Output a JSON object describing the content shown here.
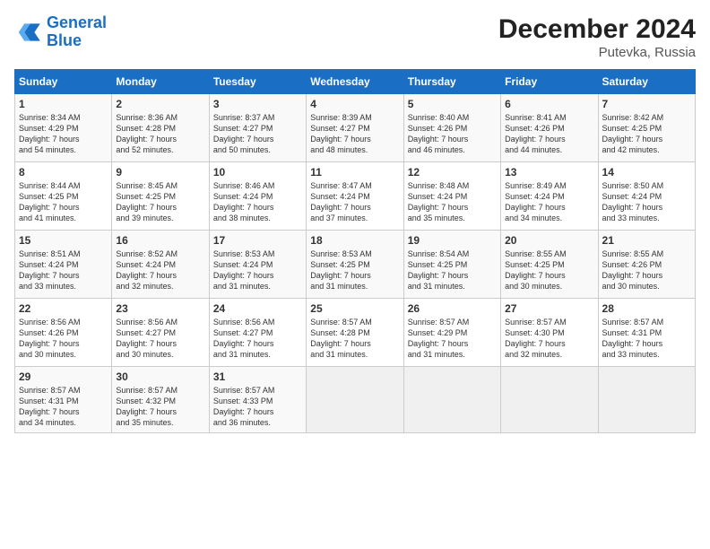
{
  "header": {
    "logo_line1": "General",
    "logo_line2": "Blue",
    "month_year": "December 2024",
    "location": "Putevka, Russia"
  },
  "weekdays": [
    "Sunday",
    "Monday",
    "Tuesday",
    "Wednesday",
    "Thursday",
    "Friday",
    "Saturday"
  ],
  "weeks": [
    [
      {
        "day": "1",
        "text": "Sunrise: 8:34 AM\nSunset: 4:29 PM\nDaylight: 7 hours\nand 54 minutes."
      },
      {
        "day": "2",
        "text": "Sunrise: 8:36 AM\nSunset: 4:28 PM\nDaylight: 7 hours\nand 52 minutes."
      },
      {
        "day": "3",
        "text": "Sunrise: 8:37 AM\nSunset: 4:27 PM\nDaylight: 7 hours\nand 50 minutes."
      },
      {
        "day": "4",
        "text": "Sunrise: 8:39 AM\nSunset: 4:27 PM\nDaylight: 7 hours\nand 48 minutes."
      },
      {
        "day": "5",
        "text": "Sunrise: 8:40 AM\nSunset: 4:26 PM\nDaylight: 7 hours\nand 46 minutes."
      },
      {
        "day": "6",
        "text": "Sunrise: 8:41 AM\nSunset: 4:26 PM\nDaylight: 7 hours\nand 44 minutes."
      },
      {
        "day": "7",
        "text": "Sunrise: 8:42 AM\nSunset: 4:25 PM\nDaylight: 7 hours\nand 42 minutes."
      }
    ],
    [
      {
        "day": "8",
        "text": "Sunrise: 8:44 AM\nSunset: 4:25 PM\nDaylight: 7 hours\nand 41 minutes."
      },
      {
        "day": "9",
        "text": "Sunrise: 8:45 AM\nSunset: 4:25 PM\nDaylight: 7 hours\nand 39 minutes."
      },
      {
        "day": "10",
        "text": "Sunrise: 8:46 AM\nSunset: 4:24 PM\nDaylight: 7 hours\nand 38 minutes."
      },
      {
        "day": "11",
        "text": "Sunrise: 8:47 AM\nSunset: 4:24 PM\nDaylight: 7 hours\nand 37 minutes."
      },
      {
        "day": "12",
        "text": "Sunrise: 8:48 AM\nSunset: 4:24 PM\nDaylight: 7 hours\nand 35 minutes."
      },
      {
        "day": "13",
        "text": "Sunrise: 8:49 AM\nSunset: 4:24 PM\nDaylight: 7 hours\nand 34 minutes."
      },
      {
        "day": "14",
        "text": "Sunrise: 8:50 AM\nSunset: 4:24 PM\nDaylight: 7 hours\nand 33 minutes."
      }
    ],
    [
      {
        "day": "15",
        "text": "Sunrise: 8:51 AM\nSunset: 4:24 PM\nDaylight: 7 hours\nand 33 minutes."
      },
      {
        "day": "16",
        "text": "Sunrise: 8:52 AM\nSunset: 4:24 PM\nDaylight: 7 hours\nand 32 minutes."
      },
      {
        "day": "17",
        "text": "Sunrise: 8:53 AM\nSunset: 4:24 PM\nDaylight: 7 hours\nand 31 minutes."
      },
      {
        "day": "18",
        "text": "Sunrise: 8:53 AM\nSunset: 4:25 PM\nDaylight: 7 hours\nand 31 minutes."
      },
      {
        "day": "19",
        "text": "Sunrise: 8:54 AM\nSunset: 4:25 PM\nDaylight: 7 hours\nand 31 minutes."
      },
      {
        "day": "20",
        "text": "Sunrise: 8:55 AM\nSunset: 4:25 PM\nDaylight: 7 hours\nand 30 minutes."
      },
      {
        "day": "21",
        "text": "Sunrise: 8:55 AM\nSunset: 4:26 PM\nDaylight: 7 hours\nand 30 minutes."
      }
    ],
    [
      {
        "day": "22",
        "text": "Sunrise: 8:56 AM\nSunset: 4:26 PM\nDaylight: 7 hours\nand 30 minutes."
      },
      {
        "day": "23",
        "text": "Sunrise: 8:56 AM\nSunset: 4:27 PM\nDaylight: 7 hours\nand 30 minutes."
      },
      {
        "day": "24",
        "text": "Sunrise: 8:56 AM\nSunset: 4:27 PM\nDaylight: 7 hours\nand 31 minutes."
      },
      {
        "day": "25",
        "text": "Sunrise: 8:57 AM\nSunset: 4:28 PM\nDaylight: 7 hours\nand 31 minutes."
      },
      {
        "day": "26",
        "text": "Sunrise: 8:57 AM\nSunset: 4:29 PM\nDaylight: 7 hours\nand 31 minutes."
      },
      {
        "day": "27",
        "text": "Sunrise: 8:57 AM\nSunset: 4:30 PM\nDaylight: 7 hours\nand 32 minutes."
      },
      {
        "day": "28",
        "text": "Sunrise: 8:57 AM\nSunset: 4:31 PM\nDaylight: 7 hours\nand 33 minutes."
      }
    ],
    [
      {
        "day": "29",
        "text": "Sunrise: 8:57 AM\nSunset: 4:31 PM\nDaylight: 7 hours\nand 34 minutes."
      },
      {
        "day": "30",
        "text": "Sunrise: 8:57 AM\nSunset: 4:32 PM\nDaylight: 7 hours\nand 35 minutes."
      },
      {
        "day": "31",
        "text": "Sunrise: 8:57 AM\nSunset: 4:33 PM\nDaylight: 7 hours\nand 36 minutes."
      },
      {
        "day": "",
        "text": ""
      },
      {
        "day": "",
        "text": ""
      },
      {
        "day": "",
        "text": ""
      },
      {
        "day": "",
        "text": ""
      }
    ]
  ]
}
